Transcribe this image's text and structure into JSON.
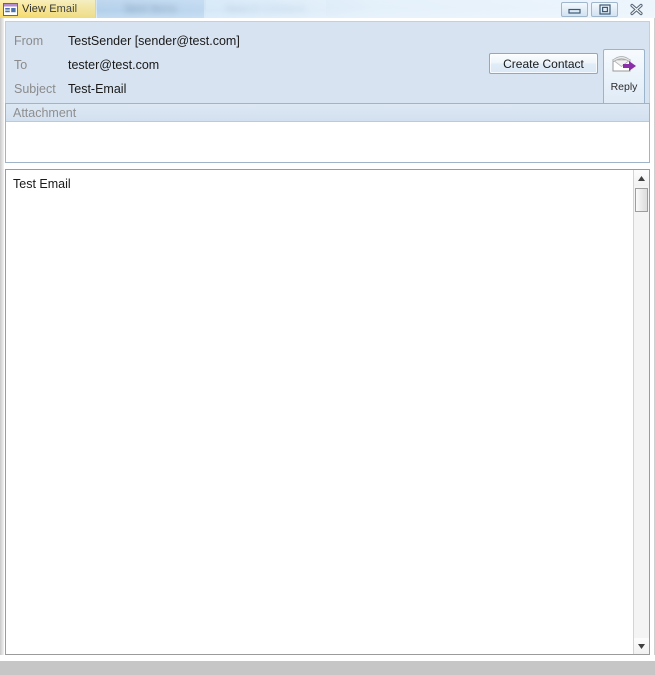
{
  "window": {
    "tabs": [
      {
        "label": "View Email",
        "icon": "form-window-icon",
        "active": true,
        "redacted": false
      },
      {
        "label": "Sent Items",
        "active": false,
        "redacted": true
      },
      {
        "label": "Search Contacts",
        "active": false,
        "redacted": true
      }
    ],
    "controls": [
      {
        "name": "minimize",
        "glyph": "minimize-icon"
      },
      {
        "name": "restore",
        "glyph": "restore-icon"
      },
      {
        "name": "close",
        "glyph": "close-icon"
      }
    ]
  },
  "header": {
    "fields": [
      {
        "label": "From",
        "value": "TestSender [sender@test.com]"
      },
      {
        "label": "To",
        "value": "tester@test.com"
      },
      {
        "label": "Subject",
        "value": "Test-Email"
      }
    ],
    "create_contact_label": "Create Contact",
    "reply_label": "Reply",
    "reply_icon": "reply-envelope-icon"
  },
  "attachment": {
    "header_label": "Attachment",
    "items": []
  },
  "body": {
    "text": "Test Email"
  },
  "scrollbar": {
    "up_icon": "caret-up-icon",
    "down_icon": "caret-down-icon",
    "thumb_position": "top"
  },
  "colors": {
    "header_panel_bg": "#d7e3f1",
    "active_tab_bg": "#f9df79",
    "attachment_header_bg": "#d3e0ef",
    "label_text": "#8b8b8b",
    "value_text": "#1a1a1a",
    "reply_arrow": "#8b2fa8",
    "footer_bar": "#c6c6c6"
  }
}
